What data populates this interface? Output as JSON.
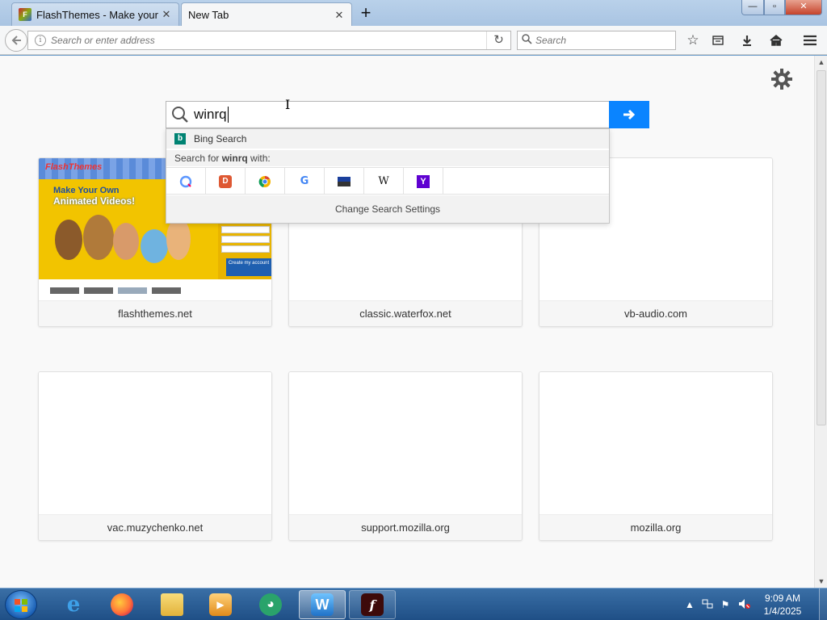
{
  "browser": {
    "tabs": [
      {
        "title": "FlashThemes - Make your o",
        "active": false
      },
      {
        "title": "New Tab",
        "active": true
      }
    ],
    "new_tab_label": "+",
    "window_controls": {
      "minimize": "—",
      "maximize": "▫",
      "close": "✕"
    },
    "address_placeholder": "Search or enter address",
    "search_placeholder": "Search"
  },
  "newtab": {
    "search_query": "winrq",
    "suggestions": {
      "bing_label": "Bing Search",
      "search_for_prefix": "Search for ",
      "search_for_term": "winrq",
      "search_for_suffix": " with:",
      "engines": [
        "qwant-icon",
        "duckduckgo-icon",
        "chrome-icon",
        "google-icon",
        "bookmarks-icon",
        "wikipedia-icon",
        "yahoo-icon"
      ],
      "change_settings": "Change Search Settings"
    },
    "tiles": [
      {
        "label": "flashthemes.net"
      },
      {
        "label": "classic.waterfox.net"
      },
      {
        "label": "vb-audio.com"
      },
      {
        "label": "vac.muzychenko.net"
      },
      {
        "label": "support.mozilla.org"
      },
      {
        "label": "mozilla.org"
      }
    ],
    "flashthemes_thumb": {
      "logo": "FlashThemes",
      "headline1": "Make Your Own",
      "headline2": "Animated Videos!",
      "create_button": "Create my account"
    }
  },
  "taskbar": {
    "apps": [
      "internet-explorer",
      "firefox",
      "file-explorer",
      "media-player",
      "greenshot",
      "waterfox",
      "flash-player"
    ],
    "clock_time": "9:09 AM",
    "clock_date": "1/4/2025"
  },
  "colors": {
    "accent": "#0a84ff",
    "bing": "#008373",
    "taskbar": "#2a5d95"
  }
}
